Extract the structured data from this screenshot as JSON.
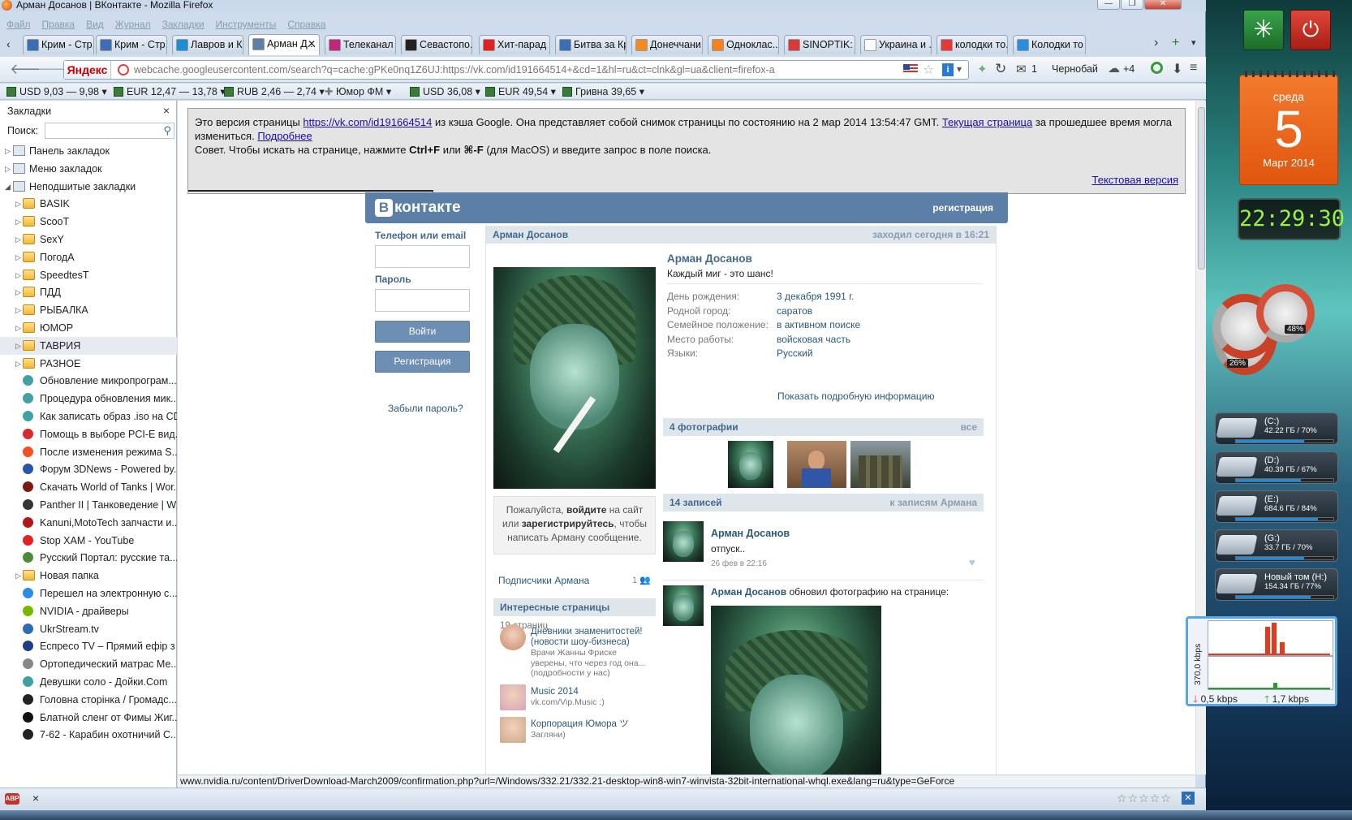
{
  "window": {
    "title": "Арман Досанов | ВКонтакте - Mozilla Firefox"
  },
  "menu": [
    "Файл",
    "Правка",
    "Вид",
    "Журнал",
    "Закладки",
    "Инструменты",
    "Справка"
  ],
  "tabs": [
    {
      "label": "Крим - Стр...",
      "icon_color": "#3b6fb5"
    },
    {
      "label": "Крим - Стр...",
      "icon_color": "#3b6fb5"
    },
    {
      "label": "Лавров и К...",
      "icon_color": "#1a8fd6"
    },
    {
      "label": "Арман Д...",
      "icon_color": "#5b7fa6",
      "active": true
    },
    {
      "label": "Телеканал ...",
      "icon_color": "#c0267c"
    },
    {
      "label": "Севастопо...",
      "icon_color": "#222222"
    },
    {
      "label": "Хит-парад ...",
      "icon_color": "#e02222"
    },
    {
      "label": "Битва за Кр...",
      "icon_color": "#3b6fb5"
    },
    {
      "label": "Донеччани...",
      "icon_color": "#f28c1e"
    },
    {
      "label": "Одноклас...",
      "icon_color": "#f58220"
    },
    {
      "label": "SINOPTIK: ...",
      "icon_color": "#d83a3a"
    },
    {
      "label": "Украина и ...",
      "icon_color": "#ffffff"
    },
    {
      "label": "колодки то...",
      "icon_color": "#e53935"
    },
    {
      "label": "Колодки то",
      "icon_color": "#2a8ddf"
    }
  ],
  "nav": {
    "yandex": "Яндекс",
    "url": "webcache.googleusercontent.com/search?q=cache:gPKe0nq1Z6UJ:https://vk.com/id191664514+&cd=1&hl=ru&ct=clnk&gl=ua&client=firefox-a",
    "mail_count": "1",
    "weather_city": "Чернобай",
    "weather_temp": "+4"
  },
  "currency": [
    {
      "label": "USD 9,03 — 9,98"
    },
    {
      "label": "EUR 12,47 — 13,78"
    },
    {
      "label": "RUB 2,46 — 2,74"
    },
    {
      "label": "Юмор ФМ"
    },
    {
      "label": "USD 36,08"
    },
    {
      "label": "EUR 49,54"
    },
    {
      "label": "Гривна 39,65"
    }
  ],
  "sidebar": {
    "title": "Закладки",
    "search_label": "Поиск:",
    "items": [
      {
        "label": "Панель закладок",
        "type": "special",
        "level": 0
      },
      {
        "label": "Меню закладок",
        "type": "special",
        "level": 0
      },
      {
        "label": "Неподшитые закладки",
        "type": "special",
        "level": 0,
        "expanded": true
      },
      {
        "label": "BASIK",
        "type": "folder"
      },
      {
        "label": "ScooT",
        "type": "folder"
      },
      {
        "label": "SexY",
        "type": "folder"
      },
      {
        "label": "ПогодА",
        "type": "folder"
      },
      {
        "label": "SpeedtesT",
        "type": "folder"
      },
      {
        "label": "ПДД",
        "type": "folder"
      },
      {
        "label": "РЫБАЛКА",
        "type": "folder"
      },
      {
        "label": "ЮМОР",
        "type": "folder"
      },
      {
        "label": "ТАВРИЯ",
        "type": "folder",
        "highlight": true
      },
      {
        "label": "РАЗНОЕ",
        "type": "folder"
      },
      {
        "label": "Обновление микропрограм...",
        "type": "link",
        "color": "#3fa1a1"
      },
      {
        "label": "Процедура обновления мик...",
        "type": "link",
        "color": "#3fa1a1"
      },
      {
        "label": "Как записать образ .iso на CD",
        "type": "link",
        "color": "#3fa1a1"
      },
      {
        "label": "Помощь в выборе PCI-E вид...",
        "type": "link",
        "color": "#d9272e"
      },
      {
        "label": "После изменения режима S...",
        "type": "link",
        "color": "#f25022"
      },
      {
        "label": "Форум 3DNews - Powered by...",
        "type": "link",
        "color": "#2a56a8"
      },
      {
        "label": "Скачать World of Tanks | Wor...",
        "type": "link",
        "color": "#7a1b10"
      },
      {
        "label": "Panther II | Танковедение | W...",
        "type": "link",
        "color": "#333333"
      },
      {
        "label": "Kanuni,MotoTech запчасти и...",
        "type": "link",
        "color": "#b01717"
      },
      {
        "label": "Stop XAM - YouTube",
        "type": "link",
        "color": "#e02222"
      },
      {
        "label": "Русский Портал: русские та...",
        "type": "link",
        "color": "#4c8a3a"
      },
      {
        "label": "Новая папка",
        "type": "folder"
      },
      {
        "label": "Перешел на электронную с...",
        "type": "link",
        "color": "#2a8ddf"
      },
      {
        "label": "NVIDIA - драйверы",
        "type": "link",
        "color": "#76b900"
      },
      {
        "label": "UkrStream.tv",
        "type": "link",
        "color": "#2d6bb5"
      },
      {
        "label": "Еспресо TV – Прямий ефір з ...",
        "type": "link",
        "color": "#1d3f8a"
      },
      {
        "label": "Ортопедический матрас Ме...",
        "type": "link",
        "color": "#888888"
      },
      {
        "label": "Девушки соло - Дойки.Com",
        "type": "link",
        "color": "#3fa1a1"
      },
      {
        "label": "Головна сторінка / Громадс...",
        "type": "link",
        "color": "#222222"
      },
      {
        "label": "Блатной сленг от Фимы Жиг...",
        "type": "link",
        "color": "#111111"
      },
      {
        "label": "7-62 - Карабин охотничий С...",
        "type": "link",
        "color": "#222222"
      }
    ]
  },
  "cache": {
    "intro": "Это версия страницы",
    "link": "https://vk.com/id191664514",
    "mid": "из кэша Google. Она представляет собой снимок страницы по состоянию на 2 мар 2014 13:54:47 GMT.",
    "current": "Текущая страница",
    "tail": "за прошедшее время могла измениться.",
    "more": "Подробнее",
    "tip_prefix": "Совет. Чтобы искать на странице, нажмите",
    "tip_key1": "Ctrl+F",
    "tip_or": "или",
    "tip_key2": "⌘-F",
    "tip_suffix": "(для MacOS) и введите запрос в поле поиска.",
    "text_version": "Текстовая версия"
  },
  "vk": {
    "logo": "контакте",
    "logo_letter": "В",
    "register_top": "регистрация",
    "login": {
      "phone_label": "Телефон или email",
      "password_label": "Пароль",
      "login_button": "Войти",
      "register_button": "Регистрация",
      "forgot": "Забыли пароль?"
    },
    "profile": {
      "header_name": "Арман Досанов",
      "last_seen": "заходил сегодня в 16:21",
      "name": "Арман Досанов",
      "status": "Каждый миг - это шанс!",
      "fields": [
        {
          "k": "День рождения:",
          "v": "3 декабря 1991 г."
        },
        {
          "k": "Родной город:",
          "v": "саратов"
        },
        {
          "k": "Семейное положение:",
          "v": "в активном поиске"
        },
        {
          "k": "Место работы:",
          "v": "войсковая часть"
        },
        {
          "k": "Языки:",
          "v": "Русский"
        }
      ],
      "show_more": "Показать подробную информацию",
      "photos_title": "4 фотографии",
      "photos_all": "все",
      "posts_title": "14 записей",
      "posts_link": "к записям Армана"
    },
    "message_note": {
      "p1": "Пожалуйста, ",
      "login": "войдите",
      "p2": " на сайт или ",
      "register": "зарегистрируйтесь",
      "p3": ", чтобы написать Арману сообщение."
    },
    "followers": {
      "label": "Подписчики Армана",
      "count": "1"
    },
    "interesting": {
      "title": "Интересные страницы",
      "count": "19 страниц",
      "items": [
        {
          "name": "Дневники знаменитостей! (новости шоу-бизнеса)",
          "desc": "Врачи Жанны Фриске уверены, что через год она... (подробности у нас)"
        },
        {
          "name": "Music 2014",
          "desc": "vk.com/Vip.Music :)"
        },
        {
          "name": "Корпорация Юмора ツ",
          "desc": "Загляни)"
        }
      ]
    },
    "posts": [
      {
        "author": "Арман Досанов",
        "text": "отпуск..",
        "date": "26 фев в 22:16"
      },
      {
        "author": "Арман Досанов",
        "action": "обновил фотографию на странице:"
      }
    ]
  },
  "status_url": "www.nvidia.ru/content/DriverDownload-March2009/confirmation.php?url=/Windows/332.21/332.21-desktop-win8-win7-winvista-32bit-international-whql.exe&lang=ru&type=GeForce",
  "desktop": {
    "calendar": {
      "weekday": "среда",
      "day": "5",
      "month": "Март 2014"
    },
    "clock": "22:29:30",
    "meters": {
      "cpu": "26%",
      "ram": "48%"
    },
    "drives": [
      {
        "name": "(C:)",
        "stats": "42.22 ГБ / 70%",
        "pct": 70
      },
      {
        "name": "(D:)",
        "stats": "40.39 ГБ / 67%",
        "pct": 67
      },
      {
        "name": "(E:)",
        "stats": "684.6 ГБ / 84%",
        "pct": 84
      },
      {
        "name": "(G:)",
        "stats": "33.7 ГБ / 70%",
        "pct": 70
      },
      {
        "name": "Новый том (H:)",
        "stats": "154.34 ГБ / 77%",
        "pct": 77
      }
    ],
    "net": {
      "scale": "370,0 kbps",
      "down": "0,5 kbps",
      "up": "1,7 kbps"
    }
  },
  "colors": {
    "vk_blue": "#5b7fa6",
    "vk_link": "#2b587a",
    "calendar": "#e8631c",
    "clock_text": "#9af04a"
  }
}
